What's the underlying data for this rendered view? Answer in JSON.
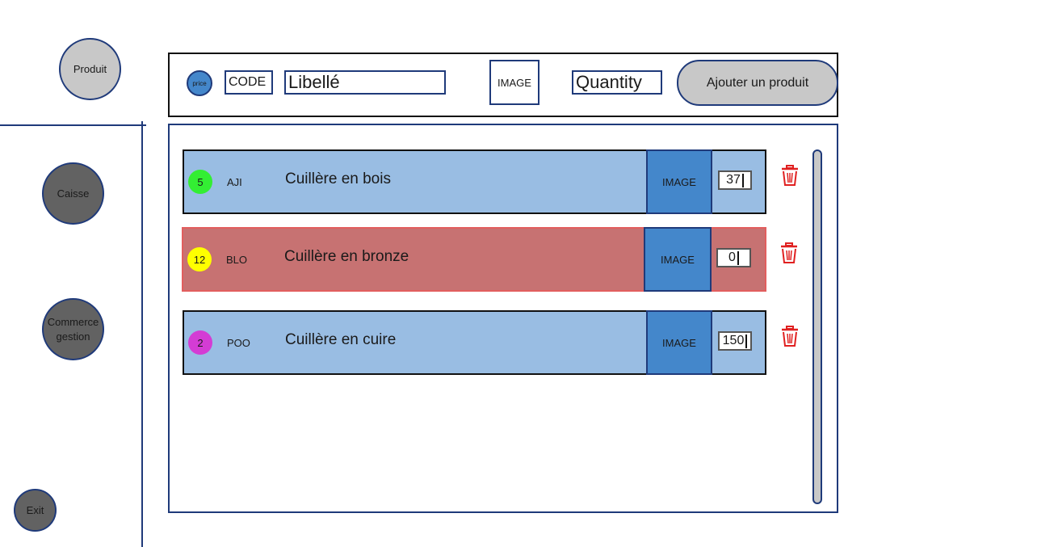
{
  "nav": {
    "produit": "Produit",
    "caisse": "Caisse",
    "commerce_line1": "Commerce",
    "commerce_line2": "gestion",
    "exit": "Exit"
  },
  "form": {
    "price_label": "price",
    "code_label": "CODE",
    "libelle_label": "Libellé",
    "image_label": "IMAGE",
    "quantity_label": "Quantity",
    "add_button": "Ajouter un produit"
  },
  "products": [
    {
      "price": "5",
      "price_color": "#33ee33",
      "code": "AJI",
      "label": "Cuillère en bois",
      "image": "IMAGE",
      "quantity": "37",
      "alert": false
    },
    {
      "price": "12",
      "price_color": "#ffff00",
      "code": "BLO",
      "label": "Cuillère en bronze",
      "image": "IMAGE",
      "quantity": "0",
      "alert": true
    },
    {
      "price": "2",
      "price_color": "#d43cd4",
      "code": "POO",
      "label": "Cuillère en cuire",
      "image": "IMAGE",
      "quantity": "150",
      "alert": false
    }
  ],
  "colors": {
    "row_normal": "#99bde3",
    "row_alert": "#c77272",
    "image_fill": "#4487cb",
    "border_blue": "#1f3a7a",
    "delete_icon": "#e02020"
  },
  "icons": {
    "delete": "trash-icon"
  }
}
